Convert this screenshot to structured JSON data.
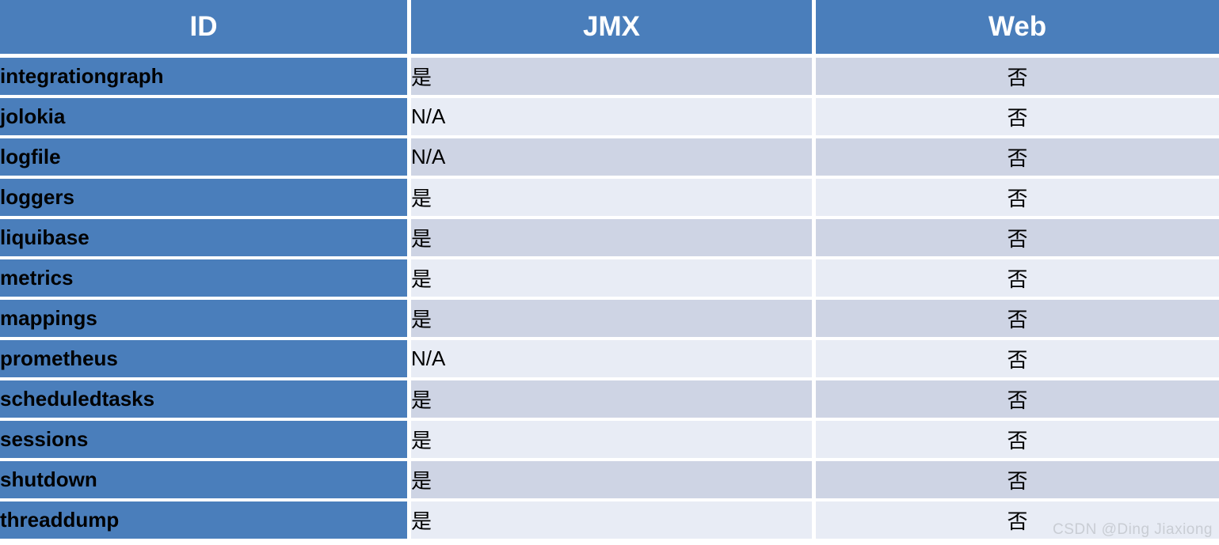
{
  "table": {
    "columns": [
      {
        "key": "id",
        "label": "ID"
      },
      {
        "key": "jmx",
        "label": "JMX"
      },
      {
        "key": "web",
        "label": "Web"
      }
    ],
    "rows": [
      {
        "id": "integrationgraph",
        "jmx": "是",
        "web": "否"
      },
      {
        "id": "jolokia",
        "jmx": "N/A",
        "web": "否"
      },
      {
        "id": "logfile",
        "jmx": "N/A",
        "web": "否"
      },
      {
        "id": "loggers",
        "jmx": "是",
        "web": "否"
      },
      {
        "id": "liquibase",
        "jmx": "是",
        "web": "否"
      },
      {
        "id": "metrics",
        "jmx": "是",
        "web": "否"
      },
      {
        "id": "mappings",
        "jmx": "是",
        "web": "否"
      },
      {
        "id": "prometheus",
        "jmx": "N/A",
        "web": "否"
      },
      {
        "id": "scheduledtasks",
        "jmx": "是",
        "web": "否"
      },
      {
        "id": "sessions",
        "jmx": "是",
        "web": "否"
      },
      {
        "id": "shutdown",
        "jmx": "是",
        "web": "否"
      },
      {
        "id": "threaddump",
        "jmx": "是",
        "web": "否"
      }
    ]
  },
  "watermark": {
    "text": "CSDN @Ding Jiaxiong"
  },
  "colors": {
    "header_blue": "#4a7ebb",
    "row_odd": "#ced4e4",
    "row_even": "#e8ecf5",
    "grid_white": "#ffffff",
    "watermark_gray": "#c9cdd4"
  }
}
